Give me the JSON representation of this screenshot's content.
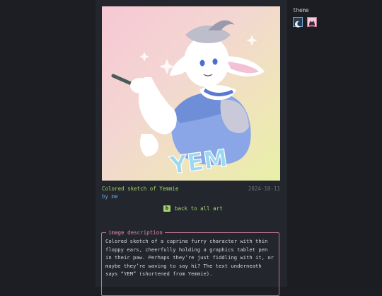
{
  "art": {
    "caption": "Colored sketch of Yemmie",
    "date": "2024-10-11",
    "by": "by me",
    "lettering": "YEM"
  },
  "nav": {
    "back_key": "b",
    "back_label": "back to all art"
  },
  "description": {
    "legend": "image description",
    "text": "Colored sketch of a caprine furry character with thin floppy ears, cheerfully holding a graphics tablet pen in their paw. Perhaps they’re just fiddling with it, or maybe they’re waving to say hi? The text underneath says “YEM” (shortened from Yemmie)."
  },
  "theme": {
    "label": "theme",
    "options": [
      {
        "name": "dark",
        "icon": "moon-icon",
        "color": "#2c3a4a"
      },
      {
        "name": "pink",
        "icon": "cat-icon",
        "color": "#f3c8d8"
      }
    ]
  }
}
